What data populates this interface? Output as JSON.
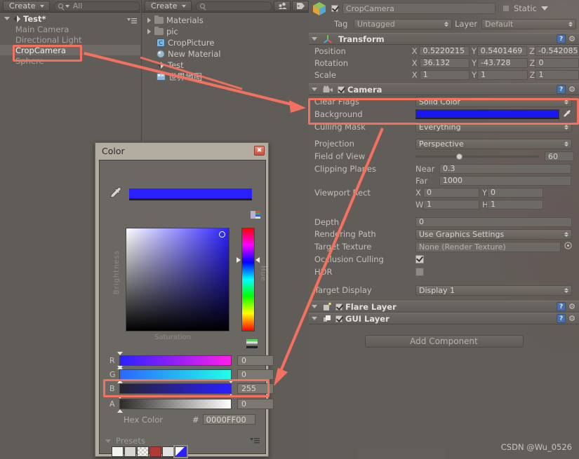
{
  "hierarchy": {
    "create_label": "Create",
    "search_placeholder": "All",
    "scene_name": "Test*",
    "items": [
      {
        "label": "Main Camera",
        "selected": false
      },
      {
        "label": "Directional Light",
        "selected": false
      },
      {
        "label": "CropCamera",
        "selected": true
      },
      {
        "label": "Sphere",
        "selected": false
      }
    ]
  },
  "project": {
    "create_label": "Create",
    "search_placeholder": "",
    "items": [
      {
        "label": "Materials",
        "icon": "folder-icon",
        "expandable": true
      },
      {
        "label": "pic",
        "icon": "folder-icon",
        "expandable": true
      },
      {
        "label": "CropPicture",
        "icon": "cs-script-icon",
        "expandable": false
      },
      {
        "label": "New Material",
        "icon": "material-sphere-icon",
        "expandable": false
      },
      {
        "label": "Test",
        "icon": "unity-scene-icon",
        "expandable": false
      },
      {
        "label": "世界地图",
        "icon": "texture-icon",
        "expandable": false
      }
    ]
  },
  "inspector": {
    "object_name": "CropCamera",
    "enabled": true,
    "static_label": "Static",
    "static_checked": false,
    "tag_label": "Tag",
    "tag_value": "Untagged",
    "layer_label": "Layer",
    "layer_value": "Default",
    "transform": {
      "title": "Transform",
      "rows": [
        {
          "label": "Position",
          "x": "0.5220215",
          "y": "0.5401469",
          "z": "-0.542085"
        },
        {
          "label": "Rotation",
          "x": "36.132",
          "y": "-43.728",
          "z": "0"
        },
        {
          "label": "Scale",
          "x": "1",
          "y": "1",
          "z": "1"
        }
      ],
      "axis_labels": [
        "X",
        "Y",
        "Z"
      ]
    },
    "camera": {
      "title": "Camera",
      "enabled": true,
      "clear_flags_label": "Clear Flags",
      "clear_flags_value": "Solid Color",
      "background_label": "Background",
      "background_color": "#1a16f0",
      "culling_mask_label": "Culling Mask",
      "culling_mask_value": "Everything",
      "projection_label": "Projection",
      "projection_value": "Perspective",
      "fov_label": "Field of View",
      "fov_value": "60",
      "fov_percent": 33,
      "clipping_label": "Clipping Planes",
      "near_label": "Near",
      "near_value": "0.3",
      "far_label": "Far",
      "far_value": "1000",
      "viewport_label": "Viewport Rect",
      "viewport_x_label": "X",
      "viewport_x": "0",
      "viewport_y_label": "Y",
      "viewport_y": "0",
      "viewport_w_label": "W",
      "viewport_w": "1",
      "viewport_h_label": "H",
      "viewport_h": "1",
      "depth_label": "Depth",
      "depth_value": "0",
      "rendering_path_label": "Rendering Path",
      "rendering_path_value": "Use Graphics Settings",
      "target_texture_label": "Target Texture",
      "target_texture_value": "None (Render Texture)",
      "occlusion_label": "Occlusion Culling",
      "occlusion_checked": true,
      "hdr_label": "HDR",
      "hdr_checked": false,
      "target_display_label": "Target Display",
      "target_display_value": "Display 1"
    },
    "flare_layer": {
      "title": "Flare Layer",
      "enabled": true
    },
    "gui_layer": {
      "title": "GUI Layer",
      "enabled": true
    },
    "add_component_label": "Add Component"
  },
  "color_picker": {
    "title": "Color",
    "close_label": "✖",
    "eyedropper": "eyedropper-icon",
    "preview_color": "#2a20ff",
    "brightness_label": "Brightness",
    "saturation_label": "Saturation",
    "hue_label": "Hue",
    "channels": [
      {
        "name": "R",
        "value": "0",
        "fill_percent": 0
      },
      {
        "name": "G",
        "value": "0",
        "fill_percent": 0
      },
      {
        "name": "B",
        "value": "255",
        "fill_percent": 100
      },
      {
        "name": "A",
        "value": "0",
        "fill_percent": 0
      }
    ],
    "hex_label": "Hex Color",
    "hex_hash": "#",
    "hex_value": "0000FF00",
    "presets_label": "Presets",
    "presets": [
      "#f2f2ef",
      "#d8d6d2",
      "#cdcbc7",
      "#b23a36",
      "#e4e2de",
      "#2a20ff"
    ]
  },
  "annotations": {
    "watermark": "CSDN @Wu_0526",
    "highlight_color": "#f4705f"
  }
}
